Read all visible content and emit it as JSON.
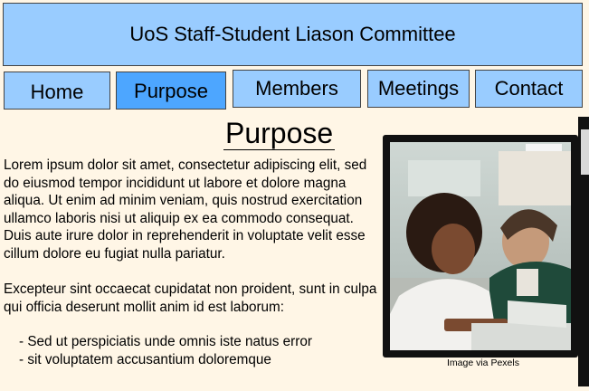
{
  "header": {
    "title": "UoS Staff-Student Liason Committee"
  },
  "nav": {
    "items": [
      {
        "label": "Home"
      },
      {
        "label": "Purpose"
      },
      {
        "label": "Members"
      },
      {
        "label": "Meetings"
      },
      {
        "label": "Contact"
      }
    ],
    "active": "Purpose"
  },
  "main": {
    "title": "Purpose",
    "paragraphs": [
      "Lorem ipsum dolor sit amet, consectetur adipiscing elit, sed do eiusmod tempor incididunt ut labore et dolore magna aliqua. Ut enim ad minim veniam, quis nostrud exercitation ullamco laboris nisi ut aliquip ex ea commodo consequat. Duis aute irure dolor in reprehenderit in voluptate velit esse cillum dolore eu fugiat nulla pariatur.",
      "Excepteur sint occaecat cupidatat non proident, sunt in culpa qui officia deserunt mollit anim id est laborum:"
    ],
    "bullets": [
      "- Sed ut perspiciatis unde omnis iste natus error",
      "- sit voluptatem accusantium doloremque"
    ],
    "image_caption": "Image via Pexels"
  },
  "colors": {
    "header_bg": "#99ccff",
    "nav_active_bg": "#4da6ff",
    "page_bg": "#fff6e6"
  }
}
